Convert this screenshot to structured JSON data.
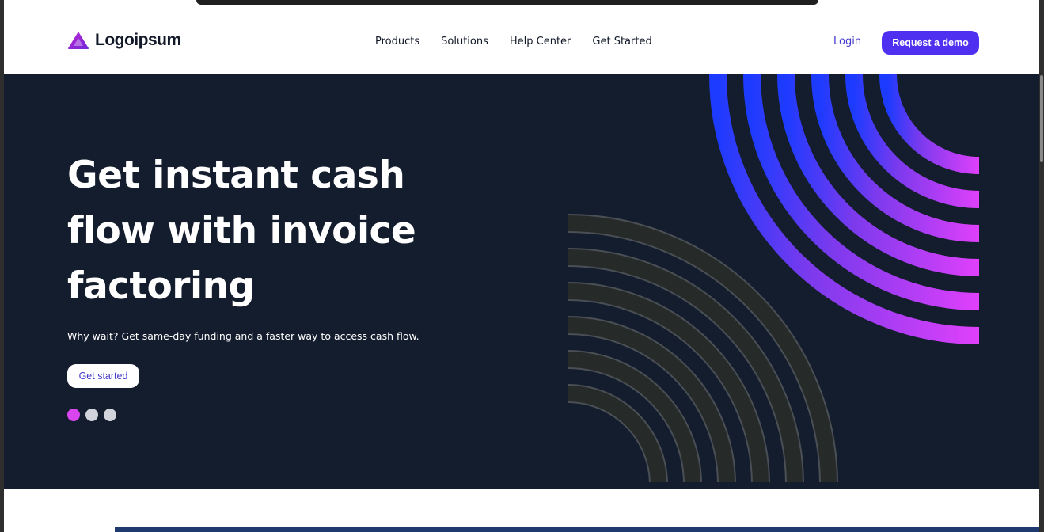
{
  "brand": {
    "name": "Logoipsum",
    "accent": "#4f2ff0",
    "logo_gradient": [
      "#c026d3",
      "#6d28d9"
    ]
  },
  "nav": {
    "items": [
      {
        "label": "Products"
      },
      {
        "label": "Solutions"
      },
      {
        "label": "Help Center"
      },
      {
        "label": "Get Started"
      }
    ],
    "login_label": "Login",
    "demo_label": "Request a demo"
  },
  "hero": {
    "title": "Get instant cash flow with invoice factoring",
    "subtitle": "Why wait? Get same-day funding and a faster way to access cash flow.",
    "cta_label": "Get started",
    "background": "#141d2d",
    "slides": {
      "count": 3,
      "active": 1
    },
    "art_colors": {
      "dark_arcs": "#262a28",
      "gradient_start": "#1d3bff",
      "gradient_end": "#e040fb"
    }
  }
}
